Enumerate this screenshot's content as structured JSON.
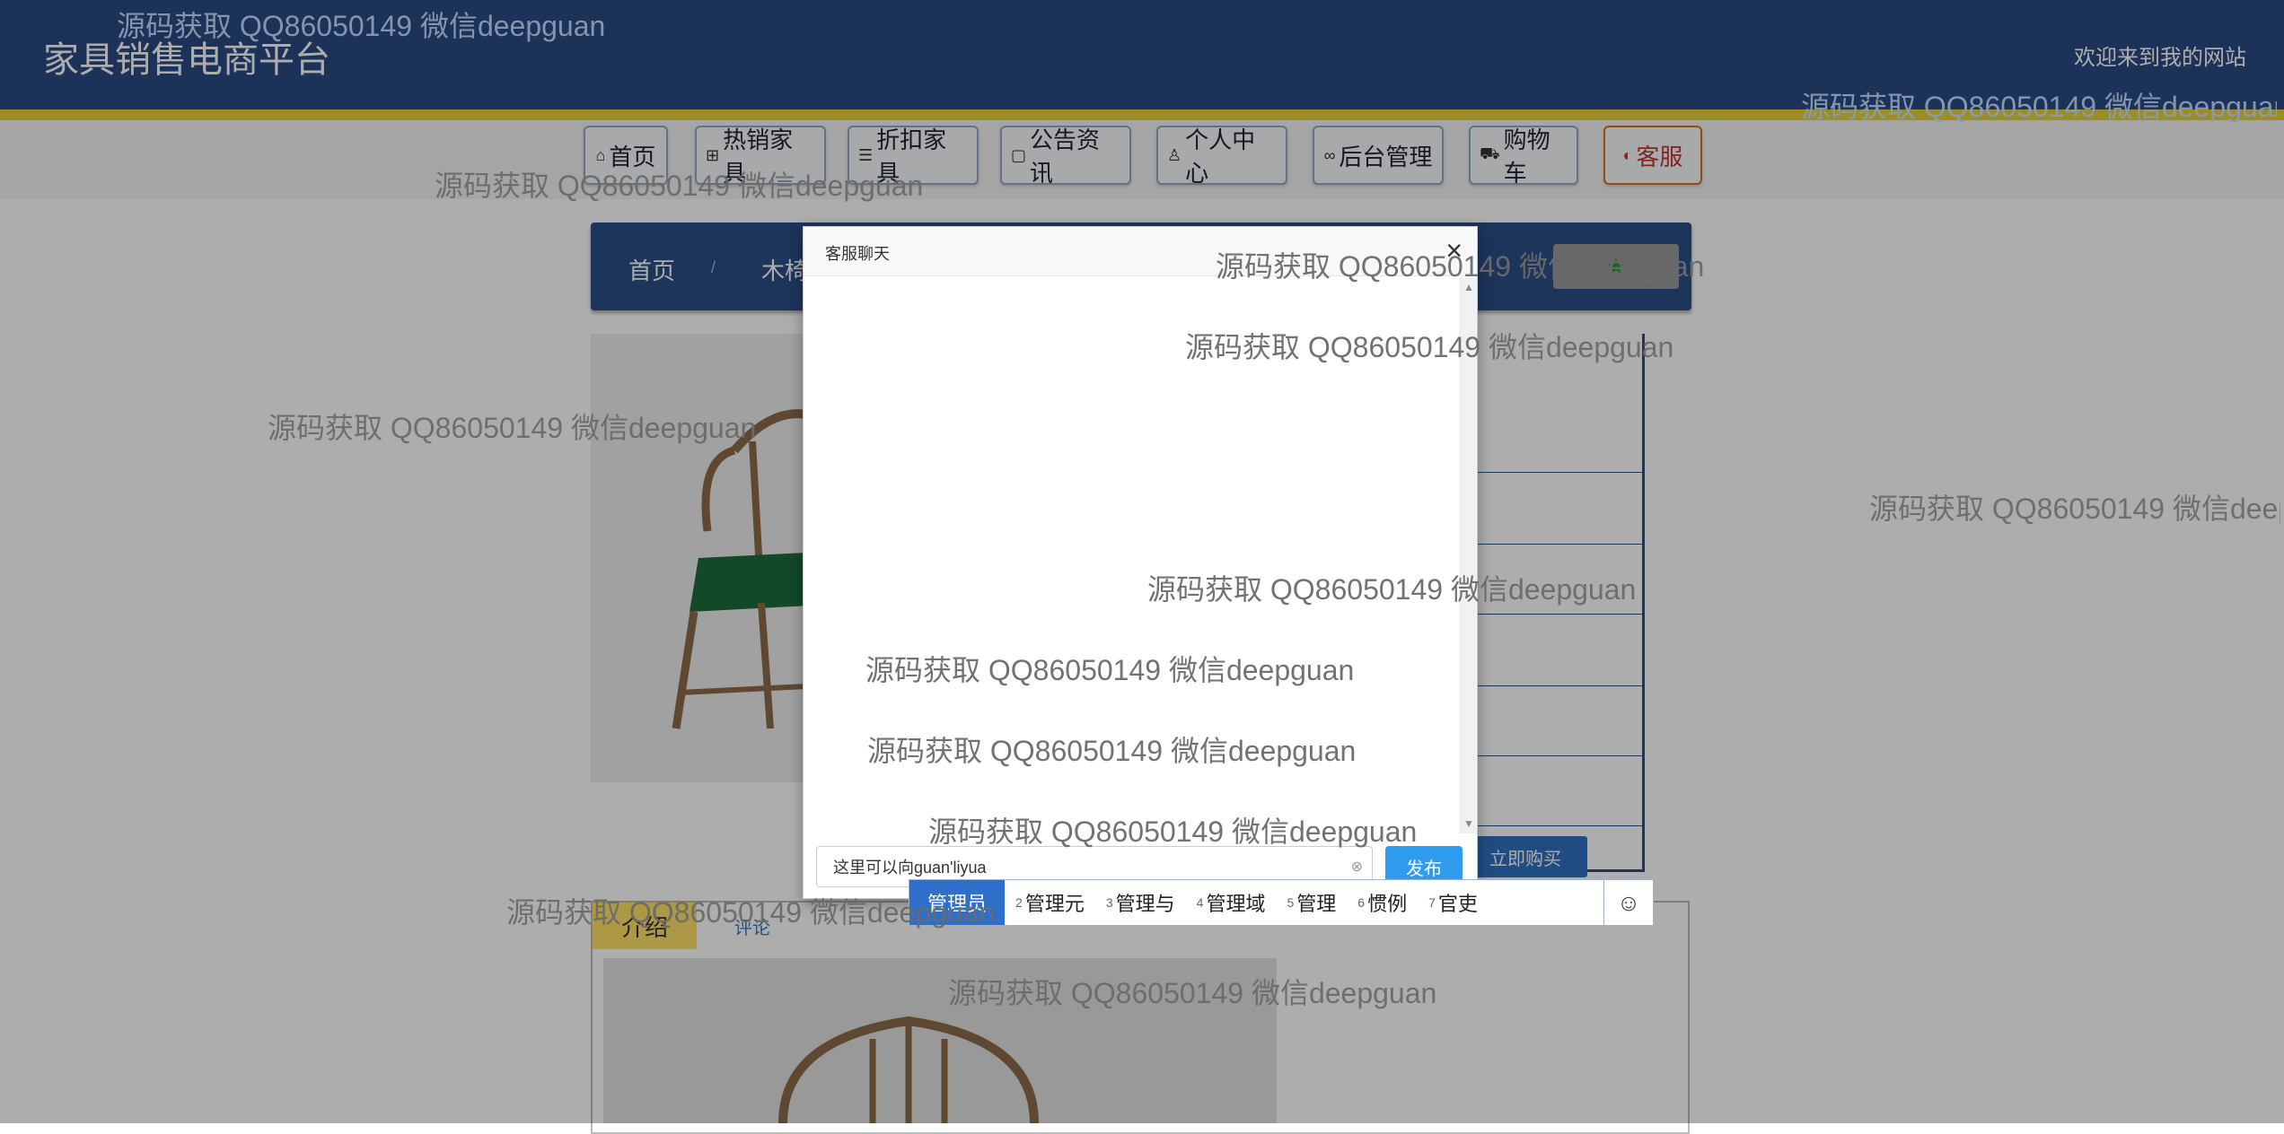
{
  "header": {
    "site_title": "家具销售电商平台",
    "welcome": "欢迎来到我的网站"
  },
  "nav": [
    {
      "icon": "home-icon",
      "label": "首页"
    },
    {
      "icon": "gift-icon",
      "label": "热销家具"
    },
    {
      "icon": "layers-icon",
      "label": "折扣家具"
    },
    {
      "icon": "edit-icon",
      "label": "公告资讯"
    },
    {
      "icon": "user-icon",
      "label": "个人中心"
    },
    {
      "icon": "link-icon",
      "label": "后台管理"
    },
    {
      "icon": "cart-icon",
      "label": "购物车"
    },
    {
      "icon": "chat-icon",
      "label": "客服"
    }
  ],
  "breadcrumb": {
    "home": "首页",
    "sep": "/",
    "category": "木椅"
  },
  "product": {
    "buy_label": "立即购买"
  },
  "tabs": {
    "intro": "介绍",
    "comment": "评论"
  },
  "modal": {
    "title": "客服聊天",
    "close": "×",
    "input_value": "这里可以向guan'liyua",
    "publish_label": "发布"
  },
  "ime": {
    "candidates": [
      {
        "num": "",
        "text": "管理员",
        "selected": true
      },
      {
        "num": "2",
        "text": "管理元"
      },
      {
        "num": "3",
        "text": "管理与"
      },
      {
        "num": "4",
        "text": "管理域"
      },
      {
        "num": "5",
        "text": "管理"
      },
      {
        "num": "6",
        "text": "惯例"
      },
      {
        "num": "7",
        "text": "官吏"
      }
    ],
    "emoji": "☺"
  },
  "watermark": "源码获取 QQ86050149 微信deepguan"
}
